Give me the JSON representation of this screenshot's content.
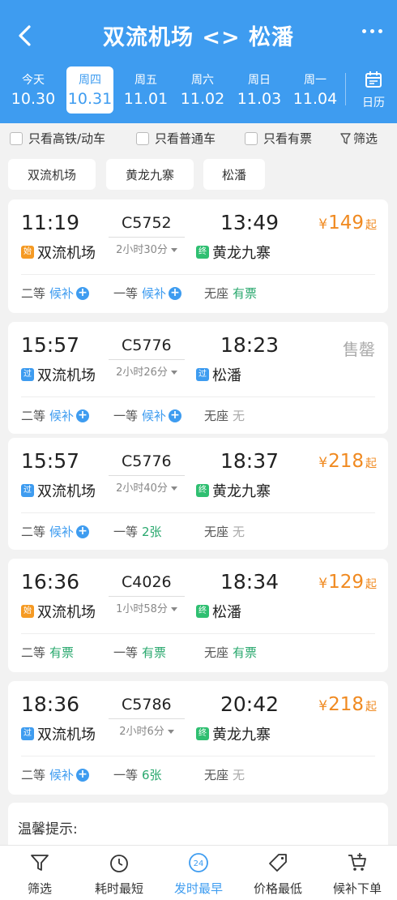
{
  "header": {
    "title": "双流机场 <> 松潘"
  },
  "dates": [
    {
      "weekday": "今天",
      "date": "10.30"
    },
    {
      "weekday": "周四",
      "date": "10.31"
    },
    {
      "weekday": "周五",
      "date": "11.01"
    },
    {
      "weekday": "周六",
      "date": "11.02"
    },
    {
      "weekday": "周日",
      "date": "11.03"
    },
    {
      "weekday": "周一",
      "date": "11.04"
    }
  ],
  "calendar_label": "日历",
  "filters": {
    "high_speed": "只看高铁/动车",
    "normal": "只看普通车",
    "available": "只看有票",
    "filter": "筛选"
  },
  "stations": [
    "双流机场",
    "黄龙九寨",
    "松潘"
  ],
  "trains": [
    {
      "dep_time": "11:19",
      "train_no": "C5752",
      "duration": "2小时30分",
      "arr_time": "13:49",
      "dep_tag": "始",
      "dep_station": "双流机场",
      "arr_tag": "终",
      "arr_station": "黄龙九寨",
      "price": "149",
      "yen": "¥",
      "qi": "起",
      "soldout": "",
      "seats": [
        {
          "cls": "二等",
          "status": "候补"
        },
        {
          "cls": "一等",
          "status": "候补"
        },
        {
          "cls": "无座",
          "status": "有票"
        }
      ]
    },
    {
      "dep_time": "15:57",
      "train_no": "C5776",
      "duration": "2小时26分",
      "arr_time": "18:23",
      "dep_tag": "过",
      "dep_station": "双流机场",
      "arr_tag": "过",
      "arr_station": "松潘",
      "price": "",
      "yen": "",
      "qi": "",
      "soldout": "售罄",
      "seats": [
        {
          "cls": "二等",
          "status": "候补"
        },
        {
          "cls": "一等",
          "status": "候补"
        },
        {
          "cls": "无座",
          "status": "无"
        }
      ]
    },
    {
      "dep_time": "15:57",
      "train_no": "C5776",
      "duration": "2小时40分",
      "arr_time": "18:37",
      "dep_tag": "过",
      "dep_station": "双流机场",
      "arr_tag": "终",
      "arr_station": "黄龙九寨",
      "price": "218",
      "yen": "¥",
      "qi": "起",
      "soldout": "",
      "seats": [
        {
          "cls": "二等",
          "status": "候补"
        },
        {
          "cls": "一等",
          "status": "2张"
        },
        {
          "cls": "无座",
          "status": "无"
        }
      ]
    },
    {
      "dep_time": "16:36",
      "train_no": "C4026",
      "duration": "1小时58分",
      "arr_time": "18:34",
      "dep_tag": "始",
      "dep_station": "双流机场",
      "arr_tag": "终",
      "arr_station": "松潘",
      "price": "129",
      "yen": "¥",
      "qi": "起",
      "soldout": "",
      "seats": [
        {
          "cls": "二等",
          "status": "有票"
        },
        {
          "cls": "一等",
          "status": "有票"
        },
        {
          "cls": "无座",
          "status": "有票"
        }
      ]
    },
    {
      "dep_time": "18:36",
      "train_no": "C5786",
      "duration": "2小时6分",
      "arr_time": "20:42",
      "dep_tag": "过",
      "dep_station": "双流机场",
      "arr_tag": "终",
      "arr_station": "黄龙九寨",
      "price": "218",
      "yen": "¥",
      "qi": "起",
      "soldout": "",
      "seats": [
        {
          "cls": "二等",
          "status": "候补"
        },
        {
          "cls": "一等",
          "status": "6张"
        },
        {
          "cls": "无座",
          "status": "无"
        }
      ]
    }
  ],
  "tips": {
    "title": "温馨提示:"
  },
  "tabbar": [
    {
      "label": "筛选",
      "icon": "filter-icon"
    },
    {
      "label": "耗时最短",
      "icon": "clock-icon"
    },
    {
      "label": "发时最早",
      "icon": "24h-icon",
      "badge": "24"
    },
    {
      "label": "价格最低",
      "icon": "price-tag-icon"
    },
    {
      "label": "候补下单",
      "icon": "cart-icon"
    }
  ],
  "colors": {
    "header_bg": "#3e9cf0",
    "price": "#f08a21",
    "available": "#2aa86e",
    "tag_start": "#f59a23",
    "tag_pass": "#3e9cf0",
    "tag_end": "#2fbf71"
  }
}
